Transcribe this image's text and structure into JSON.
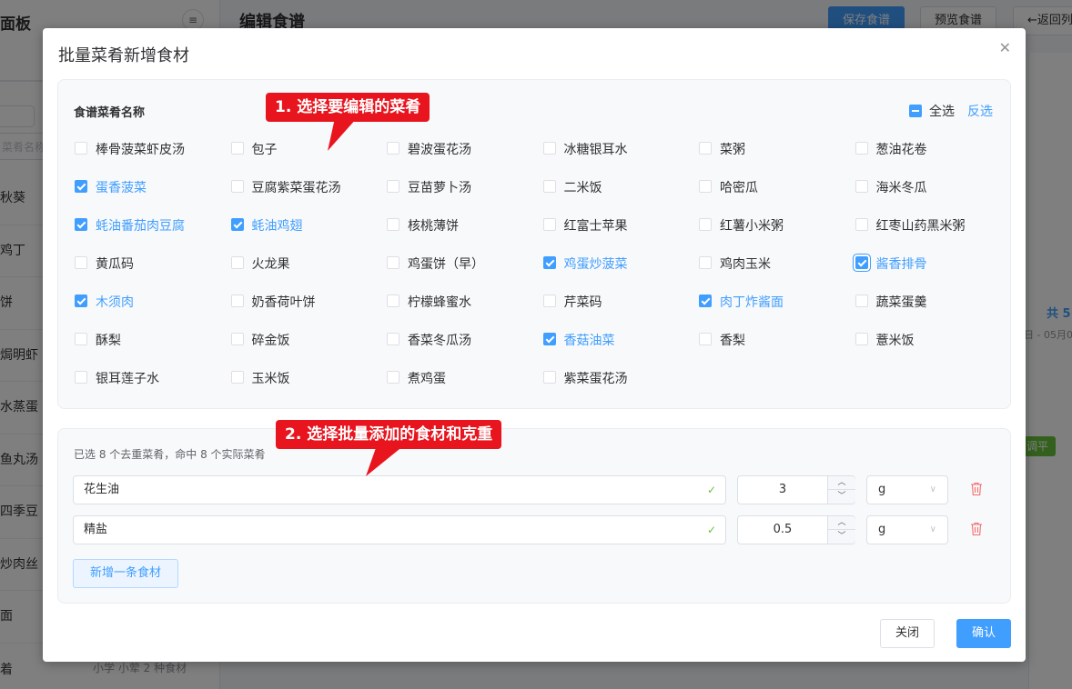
{
  "background": {
    "sidebar": {
      "title": "面板",
      "menu_icon": "hamburger-icon",
      "search_placeholder": "菜肴名称",
      "items": [
        "秋葵",
        "鸡丁",
        "饼",
        "焗明虾",
        "水蒸蛋",
        "鱼丸汤",
        "四季豆",
        "炒肉丝",
        "面"
      ],
      "footer": {
        "left": "着",
        "right": "小学   小荤  2 种食材"
      }
    },
    "main": {
      "title": "编辑食谱",
      "buttons": [
        "保存食谱",
        "预览食谱",
        "←返回列"
      ],
      "total": "共 5",
      "date": "日 - 05月0",
      "tag": "调平"
    }
  },
  "dialog": {
    "title": "批量菜肴新增食材",
    "close_icon": "close-icon",
    "dishes_panel": {
      "label": "食谱菜肴名称",
      "select_all": "全选",
      "invert": "反选",
      "dishes": [
        {
          "name": "棒骨菠菜虾皮汤",
          "checked": false
        },
        {
          "name": "包子",
          "checked": false
        },
        {
          "name": "碧波蛋花汤",
          "checked": false
        },
        {
          "name": "冰糖银耳水",
          "checked": false
        },
        {
          "name": "菜粥",
          "checked": false
        },
        {
          "name": "葱油花卷",
          "checked": false
        },
        {
          "name": "蛋香菠菜",
          "checked": true
        },
        {
          "name": "豆腐紫菜蛋花汤",
          "checked": false
        },
        {
          "name": "豆苗萝卜汤",
          "checked": false
        },
        {
          "name": "二米饭",
          "checked": false
        },
        {
          "name": "哈密瓜",
          "checked": false
        },
        {
          "name": "海米冬瓜",
          "checked": false
        },
        {
          "name": "蚝油番茄肉豆腐",
          "checked": true
        },
        {
          "name": "蚝油鸡翅",
          "checked": true
        },
        {
          "name": "核桃薄饼",
          "checked": false
        },
        {
          "name": "红富士苹果",
          "checked": false
        },
        {
          "name": "红薯小米粥",
          "checked": false
        },
        {
          "name": "红枣山药黑米粥",
          "checked": false
        },
        {
          "name": "黄瓜码",
          "checked": false
        },
        {
          "name": "火龙果",
          "checked": false
        },
        {
          "name": "鸡蛋饼（早）",
          "checked": false
        },
        {
          "name": "鸡蛋炒菠菜",
          "checked": true
        },
        {
          "name": "鸡肉玉米",
          "checked": false
        },
        {
          "name": "酱香排骨",
          "checked": true,
          "focused": true
        },
        {
          "name": "木须肉",
          "checked": true
        },
        {
          "name": "奶香荷叶饼",
          "checked": false
        },
        {
          "name": "柠檬蜂蜜水",
          "checked": false
        },
        {
          "name": "芹菜码",
          "checked": false
        },
        {
          "name": "肉丁炸酱面",
          "checked": true
        },
        {
          "name": "蔬菜蛋羹",
          "checked": false
        },
        {
          "name": "酥梨",
          "checked": false
        },
        {
          "name": "碎金饭",
          "checked": false
        },
        {
          "name": "香菜冬瓜汤",
          "checked": false
        },
        {
          "name": "香菇油菜",
          "checked": true
        },
        {
          "name": "香梨",
          "checked": false
        },
        {
          "name": "薏米饭",
          "checked": false
        },
        {
          "name": "银耳莲子水",
          "checked": false
        },
        {
          "name": "玉米饭",
          "checked": false
        },
        {
          "name": "煮鸡蛋",
          "checked": false
        },
        {
          "name": "紫菜蛋花汤",
          "checked": false
        }
      ]
    },
    "ingredients_panel": {
      "summary": "已选 8 个去重菜肴，命中 8 个实际菜肴",
      "rows": [
        {
          "name": "花生油",
          "qty": "3",
          "unit": "g"
        },
        {
          "name": "精盐",
          "qty": "0.5",
          "unit": "g"
        }
      ],
      "add_button": "新增一条食材"
    },
    "footer": {
      "close": "关闭",
      "confirm": "确认"
    }
  },
  "annotations": {
    "step1": "1. 选择要编辑的菜肴",
    "step2": "2. 选择批量添加的食材和克重"
  },
  "colors": {
    "primary": "#409eff",
    "annotation": "#e8141e",
    "success": "#67c23a",
    "danger": "#f56c6c"
  }
}
